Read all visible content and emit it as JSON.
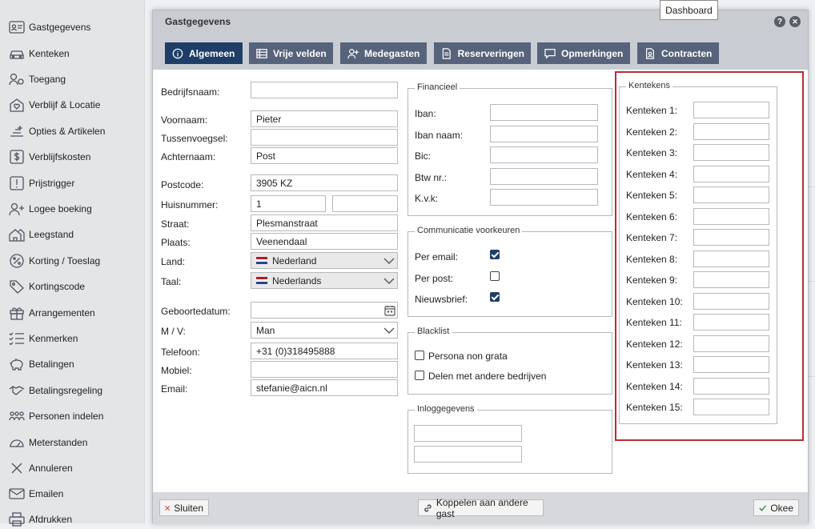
{
  "sidebar": {
    "items": [
      {
        "label": "Gastgegevens",
        "icon": "guest-card-icon"
      },
      {
        "label": "Kenteken",
        "icon": "car-icon"
      },
      {
        "label": "Toegang",
        "icon": "access-key-icon"
      },
      {
        "label": "Verblijf & Locatie",
        "icon": "house-heart-icon"
      },
      {
        "label": "Opties & Artikelen",
        "icon": "options-icon"
      },
      {
        "label": "Verblijfskosten",
        "icon": "dollar-icon"
      },
      {
        "label": "Prijstrigger",
        "icon": "exclamation-icon"
      },
      {
        "label": "Logee boeking",
        "icon": "add-person-icon"
      },
      {
        "label": "Leegstand",
        "icon": "vacant-house-icon"
      },
      {
        "label": "Korting / Toeslag",
        "icon": "percent-badge-icon"
      },
      {
        "label": "Kortingscode",
        "icon": "tag-icon"
      },
      {
        "label": "Arrangementen",
        "icon": "gift-icon"
      },
      {
        "label": "Kenmerken",
        "icon": "checklist-icon"
      },
      {
        "label": "Betalingen",
        "icon": "piggy-bank-icon"
      },
      {
        "label": "Betalingsregeling",
        "icon": "handshake-icon"
      },
      {
        "label": "Personen indelen",
        "icon": "people-group-icon"
      },
      {
        "label": "Meterstanden",
        "icon": "gauge-icon"
      },
      {
        "label": "Annuleren",
        "icon": "x-icon"
      },
      {
        "label": "Emailen",
        "icon": "envelope-icon"
      },
      {
        "label": "Afdrukken",
        "icon": "printer-icon"
      }
    ]
  },
  "tooltip": "Dashboard",
  "dialog": {
    "title": "Gastgegevens",
    "help": "?",
    "close": "✕",
    "tabs": [
      {
        "label": "Algemeen",
        "icon": "info-icon",
        "active": true
      },
      {
        "label": "Vrije velden",
        "icon": "table-icon",
        "active": false
      },
      {
        "label": "Medegasten",
        "icon": "add-person-icon",
        "active": false
      },
      {
        "label": "Reserveringen",
        "icon": "document-icon",
        "active": false
      },
      {
        "label": "Opmerkingen",
        "icon": "speech-bubble-icon",
        "active": false
      },
      {
        "label": "Contracten",
        "icon": "contract-icon",
        "active": false
      }
    ]
  },
  "form": {
    "bedrijfsnaam": {
      "label": "Bedrijfsnaam:",
      "value": ""
    },
    "voornaam": {
      "label": "Voornaam:",
      "value": "Pieter"
    },
    "tussenvoegsel": {
      "label": "Tussenvoegsel:",
      "value": ""
    },
    "achternaam": {
      "label": "Achternaam:",
      "value": "Post"
    },
    "postcode": {
      "label": "Postcode:",
      "value": "3905 KZ"
    },
    "huisnummer": {
      "label": "Huisnummer:",
      "value": "1",
      "toevoeging": ""
    },
    "straat": {
      "label": "Straat:",
      "value": "Plesmanstraat"
    },
    "plaats": {
      "label": "Plaats:",
      "value": "Veenendaal"
    },
    "land": {
      "label": "Land:",
      "value": "Nederland"
    },
    "taal": {
      "label": "Taal:",
      "value": "Nederlands"
    },
    "geboortedatum": {
      "label": "Geboortedatum:",
      "value": ""
    },
    "mv": {
      "label": "M / V:",
      "value": "Man"
    },
    "telefoon": {
      "label": "Telefoon:",
      "value": "+31 (0)318495888"
    },
    "mobiel": {
      "label": "Mobiel:",
      "value": ""
    },
    "email": {
      "label": "Email:",
      "value": "stefanie@aicn.nl"
    }
  },
  "financieel": {
    "legend": "Financieel",
    "fields": [
      {
        "label": "Iban:",
        "value": ""
      },
      {
        "label": "Iban naam:",
        "value": ""
      },
      {
        "label": "Bic:",
        "value": ""
      },
      {
        "label": "Btw nr.:",
        "value": ""
      },
      {
        "label": "K.v.k:",
        "value": ""
      }
    ]
  },
  "communicatie": {
    "legend": "Communicatie voorkeuren",
    "options": [
      {
        "label": "Per email:",
        "checked": true
      },
      {
        "label": "Per post:",
        "checked": false
      },
      {
        "label": "Nieuwsbrief:",
        "checked": true
      }
    ]
  },
  "blacklist": {
    "legend": "Blacklist",
    "options": [
      {
        "label": "Persona non grata",
        "checked": false
      },
      {
        "label": "Delen met andere bedrijven",
        "checked": false
      }
    ]
  },
  "inloggegevens": {
    "legend": "Inloggegevens",
    "username": "",
    "password": ""
  },
  "kentekens": {
    "legend": "Kentekens",
    "items": [
      {
        "label": "Kenteken 1:",
        "value": ""
      },
      {
        "label": "Kenteken 2:",
        "value": ""
      },
      {
        "label": "Kenteken 3:",
        "value": ""
      },
      {
        "label": "Kenteken 4:",
        "value": ""
      },
      {
        "label": "Kenteken 5:",
        "value": ""
      },
      {
        "label": "Kenteken 6:",
        "value": ""
      },
      {
        "label": "Kenteken 7:",
        "value": ""
      },
      {
        "label": "Kenteken 8:",
        "value": ""
      },
      {
        "label": "Kenteken 9:",
        "value": ""
      },
      {
        "label": "Kenteken 10:",
        "value": ""
      },
      {
        "label": "Kenteken 11:",
        "value": ""
      },
      {
        "label": "Kenteken 12:",
        "value": ""
      },
      {
        "label": "Kenteken 13:",
        "value": ""
      },
      {
        "label": "Kenteken 14:",
        "value": ""
      },
      {
        "label": "Kenteken 15:",
        "value": ""
      }
    ]
  },
  "footer": {
    "close_label": "Sluiten",
    "link_label": "Koppelen aan andere gast",
    "ok_label": "Okee"
  },
  "colors": {
    "tab_active": "#1f3e67",
    "tab_inactive": "#56637a",
    "highlight": "#b92d33"
  }
}
